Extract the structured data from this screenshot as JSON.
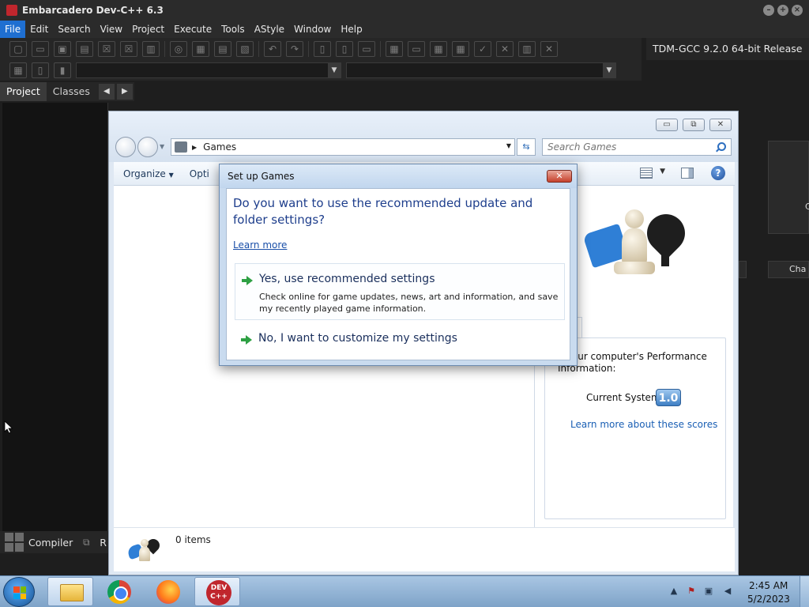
{
  "app": {
    "title": "Embarcadero Dev-C++ 6.3",
    "icon_text": "DEV C++",
    "window_controls": [
      "minimize",
      "maximize",
      "close"
    ]
  },
  "menu": {
    "items": [
      "File",
      "Edit",
      "Search",
      "View",
      "Project",
      "Execute",
      "Tools",
      "AStyle",
      "Window",
      "Help"
    ],
    "active": "File"
  },
  "toolbar": {
    "compiler": "TDM-GCC 9.2.0 64-bit Release"
  },
  "left_panel": {
    "tabs": [
      "Project",
      "Classes"
    ],
    "active_tab": "Project"
  },
  "bottom_panel": {
    "compiler_tab": "Compiler",
    "next_tab_fragment": "R"
  },
  "right_ghost": {
    "fragment_1": "C",
    "fragment_2": "Cha"
  },
  "games_window": {
    "address": "Games",
    "search_placeholder": "Search Games",
    "commands": {
      "organize": "Organize",
      "options_fragment": "Opti"
    },
    "performance": {
      "text_fragment": "k your computer's Performance Information:",
      "current_system_label": "Current System",
      "score": "1.0",
      "scores_link": "Learn more about these scores"
    },
    "status": {
      "items": "0 items"
    },
    "controls": {
      "minimize": "▭",
      "maximize": "⧉",
      "close": "✕"
    }
  },
  "dialog": {
    "title": "Set up Games",
    "question": "Do you want to use the recommended update and folder settings?",
    "learn_more": "Learn more",
    "option_recommended": {
      "title": "Yes, use recommended settings",
      "description": "Check online for game updates, news, art and information, and save my recently played game information."
    },
    "option_customize": {
      "title": "No, I want to customize my settings"
    },
    "close": "✕"
  },
  "taskbar": {
    "apps": [
      "Windows Explorer",
      "Google Chrome",
      "Mozilla Firefox",
      "Dev-C++"
    ],
    "devcpp_badge": "DEV C++",
    "clock_time": "2:45 AM",
    "clock_date": "5/2/2023"
  }
}
